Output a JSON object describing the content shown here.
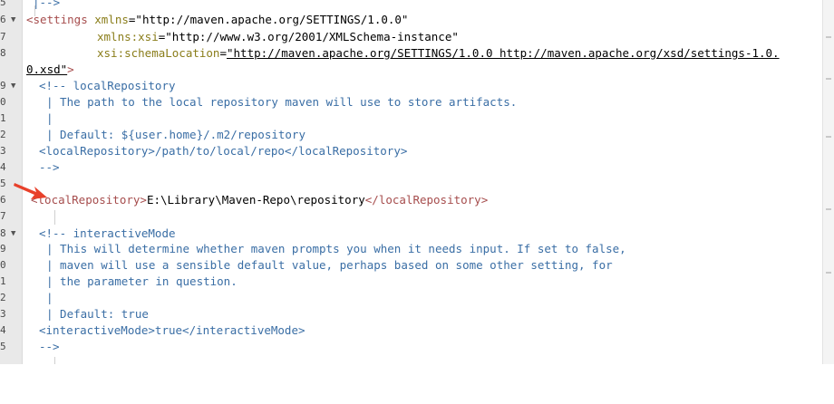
{
  "editor": {
    "line_numbers": [
      "5",
      "6",
      "7",
      "8",
      "",
      "9",
      "0",
      "1",
      "2",
      "3",
      "4",
      "5",
      "",
      "6",
      "",
      "7",
      "8",
      "9",
      "0",
      "1",
      "2",
      "3",
      "4",
      "5",
      ""
    ],
    "lines": {
      "l1": {
        "t1": "|-->"
      },
      "l2": {
        "t1": "<settings",
        "t2": " xmlns",
        "t3": "=",
        "t4": "\"http://maven.apache.org/SETTINGS/1.0.0\""
      },
      "l3": {
        "t1": "xmlns:xsi",
        "t2": "=",
        "t3": "\"http://www.w3.org/2001/XMLSchema-instance\""
      },
      "l4": {
        "t1": "xsi:schemaLocation",
        "t2": "=",
        "t3": "\"http://maven.apache.org/SETTINGS/1.0.0",
        "t4": " http://maven.apache.org/xsd/settings-1.0."
      },
      "l5": {
        "t1": "0.xsd\"",
        "t2": ">"
      },
      "l6": {
        "t1": "<!-- localRepository"
      },
      "l7": {
        "t1": "| The path to the local repository maven will use to store artifacts."
      },
      "l8": {
        "t1": "|"
      },
      "l9": {
        "t1": "| Default: ${user.home}/.m2/repository"
      },
      "l10": {
        "t1": "<localRepository>/path/to/local/repo</localRepository>"
      },
      "l11": {
        "t1": "-->"
      },
      "l13": {
        "t1": "<localRepository>",
        "t2": "E:\\Library\\Maven-Repo\\repository",
        "t3": "</localRepository>"
      },
      "l15": {
        "t1": "<!-- interactiveMode"
      },
      "l16": {
        "t1": "| This will determine whether maven prompts you when it needs input. If set to false,"
      },
      "l17": {
        "t1": "| maven will use a sensible default value, perhaps based on some other setting, for"
      },
      "l18": {
        "t1": "| the parameter in question."
      },
      "l19": {
        "t1": "|"
      },
      "l20": {
        "t1": "| Default: true"
      },
      "l21": {
        "t1": "<interactiveMode>true</interactiveMode>"
      },
      "l22": {
        "t1": "-->"
      }
    },
    "colors": {
      "comment": "#3a6ea5",
      "tag": "#a64d4d",
      "attribute": "#8a7d1a",
      "arrow": "#e8402a"
    },
    "annotation_icon": "red-arrow-icon"
  }
}
